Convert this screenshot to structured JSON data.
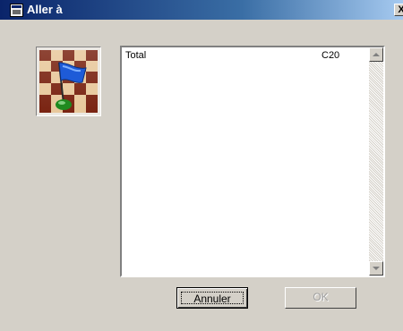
{
  "window": {
    "title": "Aller à",
    "close_label": "X"
  },
  "list": {
    "rows": [
      {
        "name": "Total",
        "code": "C20"
      }
    ]
  },
  "buttons": {
    "cancel_label": "Annuler",
    "ok_label": "OK",
    "ok_enabled": false
  },
  "colors": {
    "titlebar_start": "#0a246a",
    "titlebar_end": "#a6caf0",
    "dialog_bg": "#d4d0c8",
    "flag_blue": "#1e5bd8",
    "flag_base_green": "#1f8a1f"
  },
  "icons": {
    "app": "dialog-app-icon",
    "logo": "chessboard-flag-icon"
  }
}
